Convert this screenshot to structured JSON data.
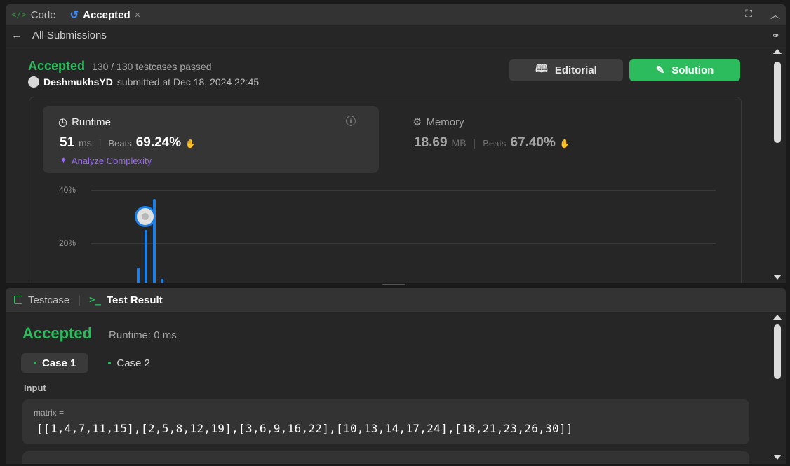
{
  "tabs": {
    "code_label": "Code",
    "accepted_label": "Accepted",
    "close_symbol": "×"
  },
  "subbar": {
    "back_symbol": "←",
    "title": "All Submissions"
  },
  "submission": {
    "status": "Accepted",
    "testcases": "130 / 130 testcases passed",
    "username": "DeshmukhsYD",
    "submitted_at": "submitted at Dec 18, 2024 22:45"
  },
  "buttons": {
    "editorial": "Editorial",
    "solution": "Solution"
  },
  "runtime": {
    "title": "Runtime",
    "value": "51",
    "unit": "ms",
    "beats_label": "Beats",
    "beats_pct": "69.24%",
    "analyze": "Analyze Complexity"
  },
  "memory": {
    "title": "Memory",
    "value": "18.69",
    "unit": "MB",
    "beats_label": "Beats",
    "beats_pct": "67.40%"
  },
  "chart": {
    "y_labels": [
      "40%",
      "20%"
    ]
  },
  "bottom": {
    "testcase_tab": "Testcase",
    "result_tab": "Test Result",
    "result_status": "Accepted",
    "result_runtime": "Runtime: 0 ms",
    "cases": [
      "Case 1",
      "Case 2"
    ],
    "input_label": "Input",
    "var_name": "matrix =",
    "var_value": "[[1,4,7,11,15],[2,5,8,12,19],[3,6,9,16,22],[10,13,14,17,24],[18,21,23,26,30]]"
  },
  "colors": {
    "accent_green": "#2cbb5d",
    "bar_blue": "#1a7fe8",
    "purple": "#9b6cf0"
  }
}
